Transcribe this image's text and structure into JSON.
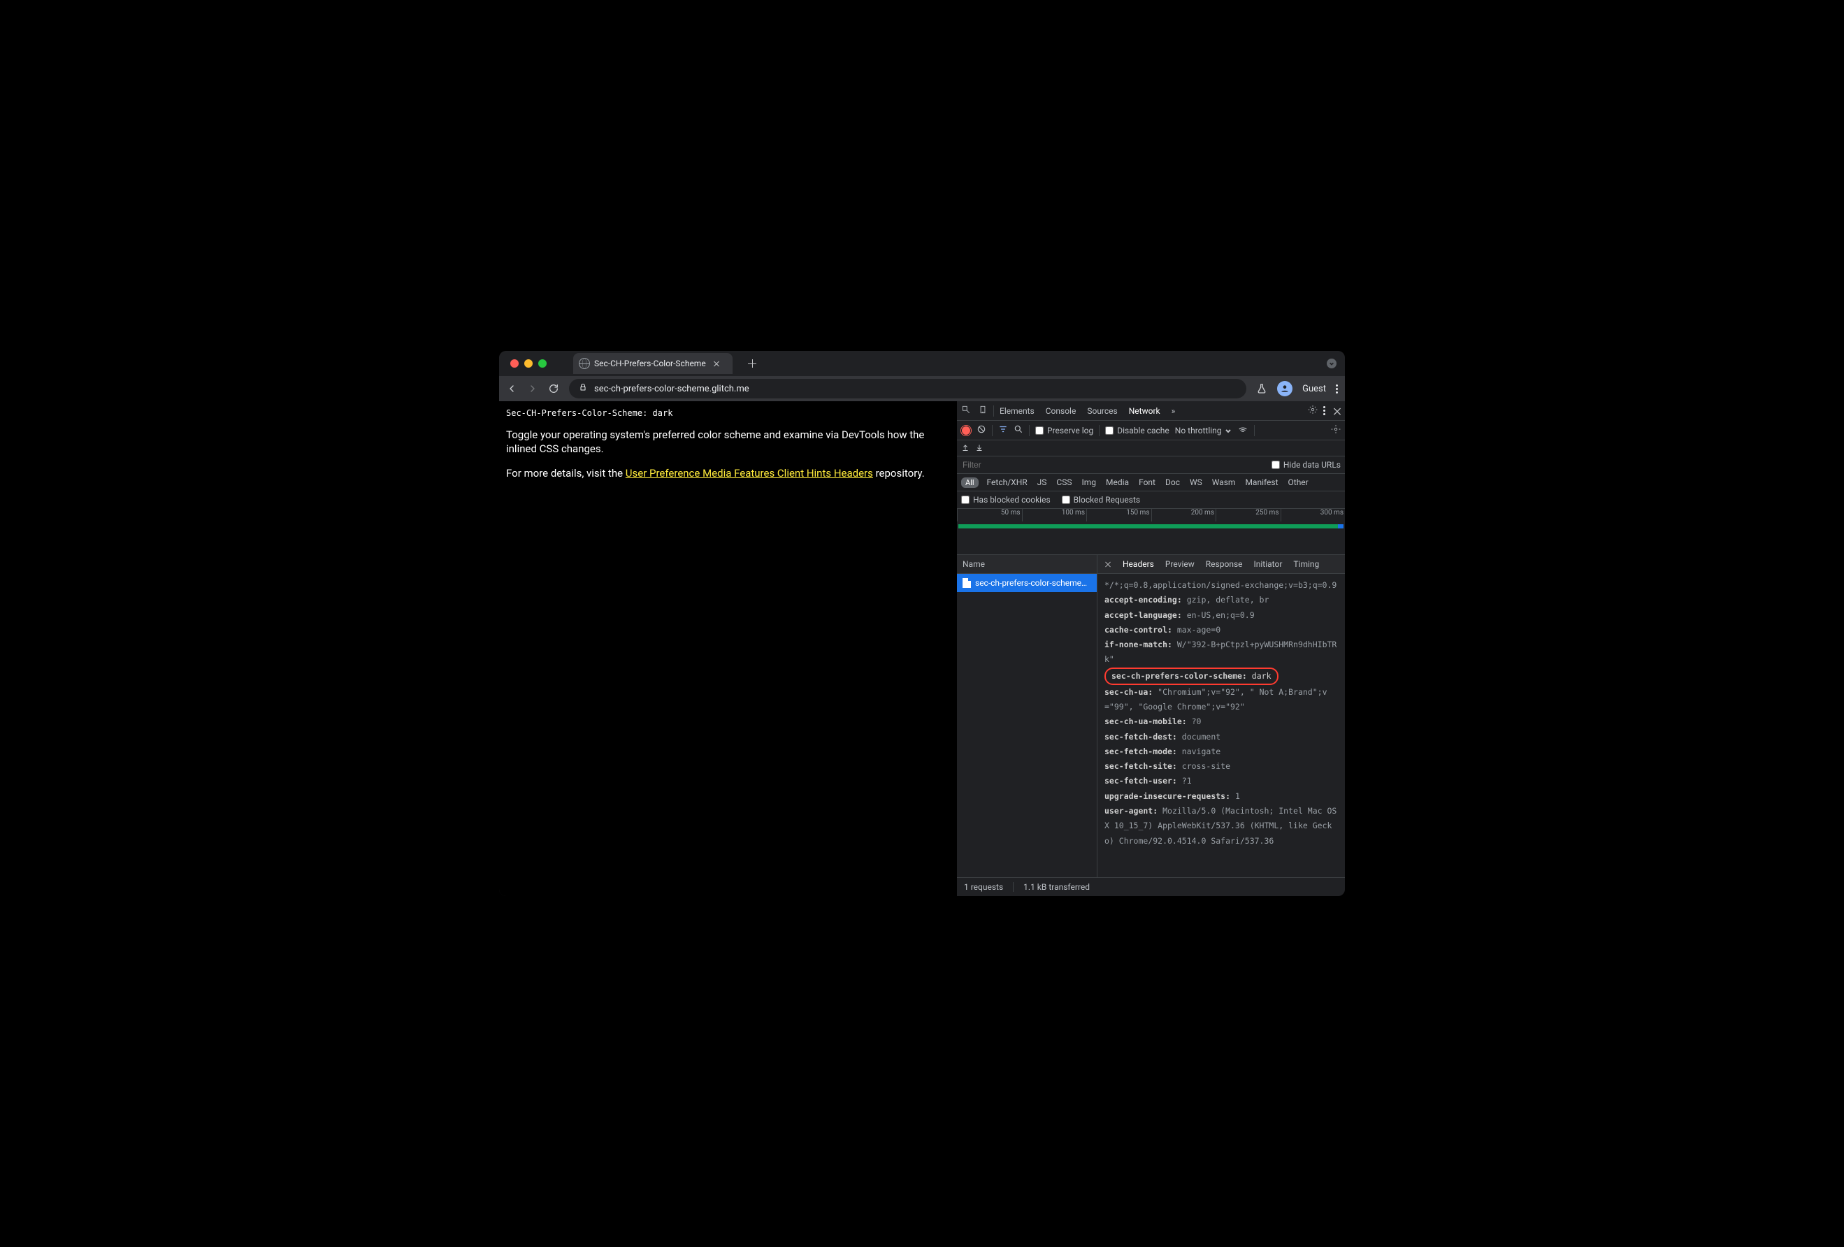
{
  "tab": {
    "title": "Sec-CH-Prefers-Color-Scheme"
  },
  "toolbar": {
    "url": "sec-ch-prefers-color-scheme.glitch.me",
    "guest_label": "Guest"
  },
  "page": {
    "header_mono": "Sec-CH-Prefers-Color-Scheme: dark",
    "p1": "Toggle your operating system's preferred color scheme and examine via DevTools how the inlined CSS changes.",
    "p2a": "For more details, visit the ",
    "link": "User Preference Media Features Client Hints Headers",
    "p2b": " repository."
  },
  "devtools": {
    "panels": [
      "Elements",
      "Console",
      "Sources",
      "Network"
    ],
    "active_panel": "Network",
    "toolbar2": {
      "preserve_log": "Preserve log",
      "disable_cache": "Disable cache",
      "throttling": "No throttling"
    },
    "filterbar": {
      "filter_placeholder": "Filter",
      "hide_data_urls": "Hide data URLs",
      "types": [
        "All",
        "Fetch/XHR",
        "JS",
        "CSS",
        "Img",
        "Media",
        "Font",
        "Doc",
        "WS",
        "Wasm",
        "Manifest",
        "Other"
      ],
      "has_blocked_cookies": "Has blocked cookies",
      "blocked_requests": "Blocked Requests"
    },
    "timeline_ticks": [
      "50 ms",
      "100 ms",
      "150 ms",
      "200 ms",
      "250 ms",
      "300 ms"
    ],
    "name_header": "Name",
    "request_item": "sec-ch-prefers-color-scheme…",
    "detail_tabs": [
      "Headers",
      "Preview",
      "Response",
      "Initiator",
      "Timing"
    ],
    "headers": [
      {
        "pre": "*/*;q=0.8,application/signed-exchange;v=b3;q=0.9"
      },
      {
        "k": "accept-encoding:",
        "v": " gzip, deflate, br"
      },
      {
        "k": "accept-language:",
        "v": " en-US,en;q=0.9"
      },
      {
        "k": "cache-control:",
        "v": " max-age=0"
      },
      {
        "k": "if-none-match:",
        "v": " W/\"392-B+pCtpzl+pyWUSHMRn9dhHIbTRk\""
      },
      {
        "hl": true,
        "k": "sec-ch-prefers-color-scheme:",
        "v": " dark"
      },
      {
        "k": "sec-ch-ua:",
        "v": " \"Chromium\";v=\"92\", \" Not A;Brand\";v=\"99\", \"Google Chrome\";v=\"92\""
      },
      {
        "k": "sec-ch-ua-mobile:",
        "v": " ?0"
      },
      {
        "k": "sec-fetch-dest:",
        "v": " document"
      },
      {
        "k": "sec-fetch-mode:",
        "v": " navigate"
      },
      {
        "k": "sec-fetch-site:",
        "v": " cross-site"
      },
      {
        "k": "sec-fetch-user:",
        "v": " ?1"
      },
      {
        "k": "upgrade-insecure-requests:",
        "v": " 1"
      },
      {
        "k": "user-agent:",
        "v": " Mozilla/5.0 (Macintosh; Intel Mac OS X 10_15_7) AppleWebKit/537.36 (KHTML, like Gecko) Chrome/92.0.4514.0 Safari/537.36"
      }
    ],
    "status": {
      "requests": "1 requests",
      "transferred": "1.1 kB transferred"
    }
  }
}
